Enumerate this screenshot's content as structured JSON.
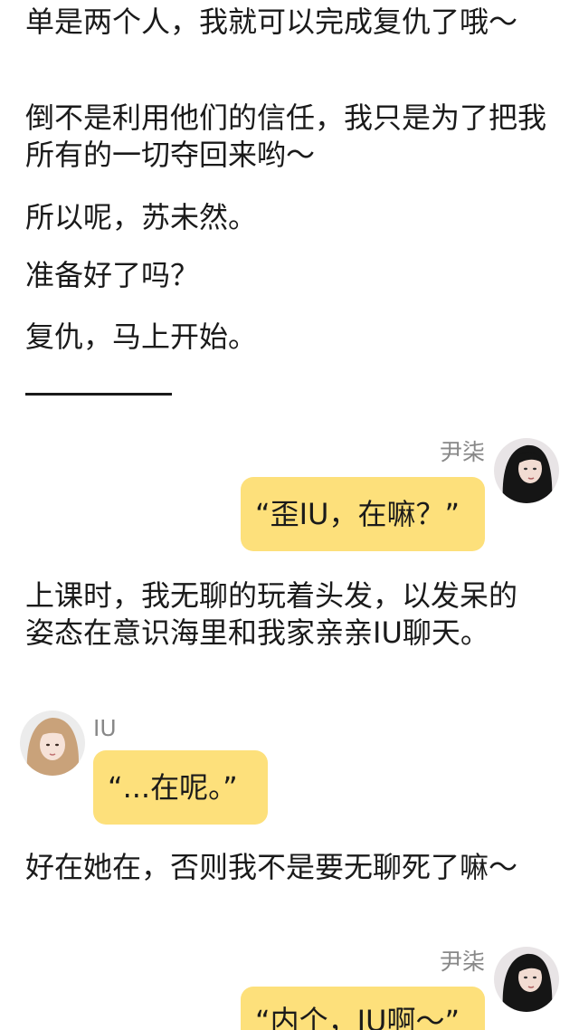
{
  "story": {
    "p1": "单是两个人，我就可以完成复仇了哦～",
    "p2": "倒不是利用他们的信任，我只是为了把我所有的一切夺回来哟～",
    "p3": "所以呢，苏未然。",
    "p4": "准备好了吗？",
    "p5": "复仇，马上开始。",
    "p6": "上课时，我无聊的玩着头发，以发呆的姿态在意识海里和我家亲亲IU聊天。",
    "p7": "好在她在，否则我不是要无聊死了嘛～"
  },
  "messages": [
    {
      "sender": "尹柒",
      "text": "“歪IU，在嘛？”",
      "side": "right"
    },
    {
      "sender": "IU",
      "text": "“...在呢。”",
      "side": "left"
    },
    {
      "sender": "尹柒",
      "text": "“内个，IU啊～”",
      "side": "right"
    }
  ],
  "colors": {
    "bubble": "#fde07b",
    "text": "#1a1a1a",
    "name": "#888888"
  }
}
